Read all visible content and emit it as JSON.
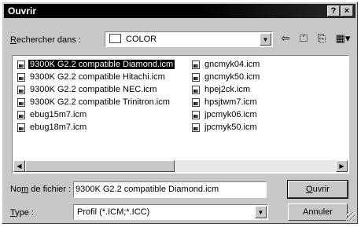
{
  "window": {
    "title": "Ouvrir",
    "help_label": "?",
    "close_label": "×"
  },
  "lookin": {
    "label_pre": "",
    "label_u": "R",
    "label_post": "echercher dans :",
    "folder": "COLOR"
  },
  "toolbar": {
    "back_icon": "back-arrow-icon",
    "up_icon": "up-folder-icon",
    "newfolder_icon": "new-folder-icon",
    "views_icon": "view-menu-icon"
  },
  "files_left": [
    "9300K G2.2 compatible Diamond.icm",
    "9300K G2.2 compatible Hitachi.icm",
    "9300K G2.2 compatible NEC.icm",
    "9300K G2.2 compatible Trinitron.icm",
    "ebug15m7.icm",
    "ebug18m7.icm"
  ],
  "files_right": [
    "gncmyk04.icm",
    "gncmyk50.icm",
    "hpej2ck.icm",
    "hpsjtwm7.icm",
    "jpcmyk06.icm",
    "jpcmyk50.icm"
  ],
  "selected_file": "9300K G2.2 compatible Diamond.icm",
  "filename": {
    "label_pre": "No",
    "label_u": "m",
    "label_post": " de fichier :",
    "value": "9300K G2.2 compatible Diamond.icm"
  },
  "filetype": {
    "label_pre": "",
    "label_u": "T",
    "label_post": "ype :",
    "value": "Profil (*.ICM;*.ICC)"
  },
  "buttons": {
    "open_pre": "",
    "open_u": "O",
    "open_post": "uvrir",
    "cancel": "Annuler"
  }
}
